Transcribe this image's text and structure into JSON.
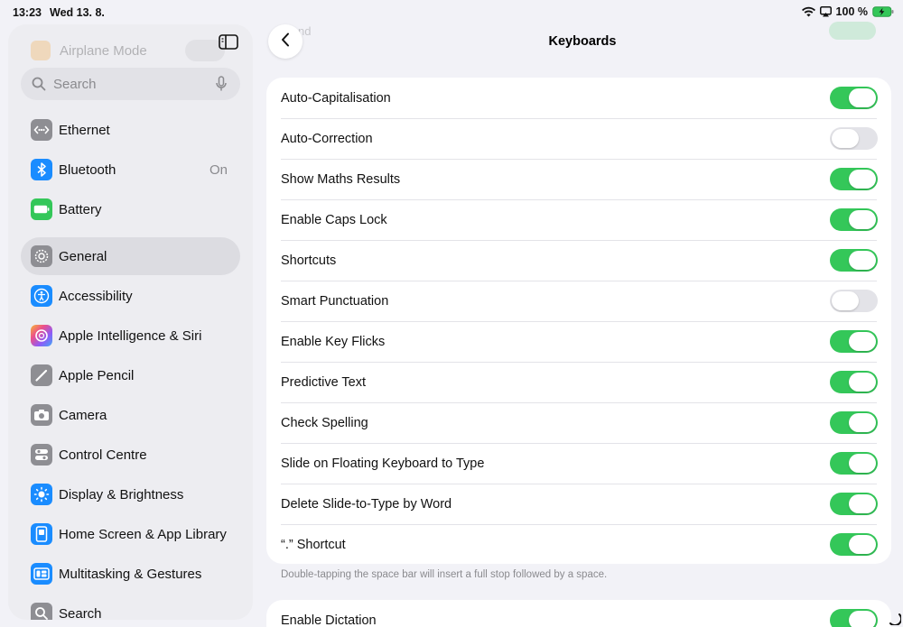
{
  "status_bar": {
    "time": "13:23",
    "date": "Wed 13. 8.",
    "battery": "100 %"
  },
  "sidebar": {
    "ghost_item": "Airplane Mode",
    "search_placeholder": "Search",
    "items": [
      {
        "label": "Ethernet",
        "icon": "ethernet-icon",
        "color": "#8e8e93"
      },
      {
        "label": "Bluetooth",
        "value": "On",
        "icon": "bluetooth-icon",
        "color": "#1a8cff"
      },
      {
        "label": "Battery",
        "icon": "battery-icon",
        "color": "#34c759"
      },
      {
        "label": "General",
        "icon": "gear-icon",
        "color": "#8e8e93",
        "selected": true
      },
      {
        "label": "Accessibility",
        "icon": "accessibility-icon",
        "color": "#1a8cff"
      },
      {
        "label": "Apple Intelligence & Siri",
        "icon": "siri-icon",
        "color": "#c94fd6"
      },
      {
        "label": "Apple Pencil",
        "icon": "pencil-icon",
        "color": "#8e8e93"
      },
      {
        "label": "Camera",
        "icon": "camera-icon",
        "color": "#8e8e93"
      },
      {
        "label": "Control Centre",
        "icon": "control-centre-icon",
        "color": "#8e8e93"
      },
      {
        "label": "Display & Brightness",
        "icon": "sun-icon",
        "color": "#1a8cff"
      },
      {
        "label": "Home Screen & App Library",
        "icon": "home-screen-icon",
        "color": "#1a8cff"
      },
      {
        "label": "Multitasking & Gestures",
        "icon": "multitasking-icon",
        "color": "#1a8cff"
      },
      {
        "label": "Search",
        "icon": "search-icon",
        "color": "#8e8e93"
      }
    ]
  },
  "header": {
    "title": "Keyboards",
    "ghost_text": "nd"
  },
  "settings": {
    "rows": [
      {
        "label": "Auto-Capitalisation",
        "on": true
      },
      {
        "label": "Auto-Correction",
        "on": false
      },
      {
        "label": "Show Maths Results",
        "on": true
      },
      {
        "label": "Enable Caps Lock",
        "on": true
      },
      {
        "label": "Shortcuts",
        "on": true
      },
      {
        "label": "Smart Punctuation",
        "on": false
      },
      {
        "label": "Enable Key Flicks",
        "on": true
      },
      {
        "label": "Predictive Text",
        "on": true
      },
      {
        "label": "Check Spelling",
        "on": true
      },
      {
        "label": "Slide on Floating Keyboard to Type",
        "on": true
      },
      {
        "label": "Delete Slide-to-Type by Word",
        "on": true
      },
      {
        "label": "“.” Shortcut",
        "on": true
      }
    ],
    "footnote": "Double-tapping the space bar will insert a full stop followed by a space.",
    "dictation": {
      "label": "Enable Dictation",
      "on": true
    }
  },
  "colors": {
    "toggle_on": "#34c759",
    "toggle_off": "#e3e3e8",
    "background": "#f2f2f7"
  }
}
